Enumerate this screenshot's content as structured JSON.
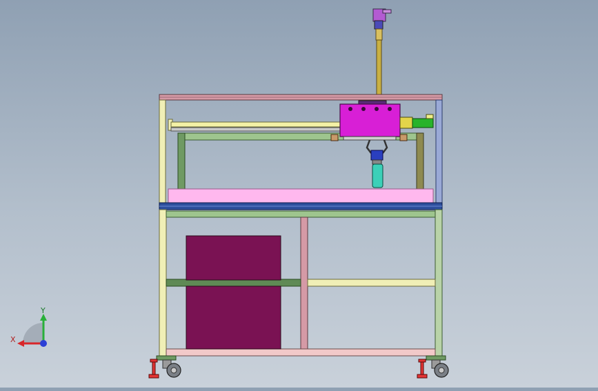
{
  "viewport": {
    "background_top": "#8fa0b3",
    "background_bottom": "#c9d1da"
  },
  "axis_triad": {
    "x_label": "X",
    "y_label": "Y",
    "x_color": "#d8262a",
    "y_color": "#29b03a",
    "z_color": "#2b3fd6"
  },
  "colors": {
    "frame_green": "#6f9a63",
    "frame_light_green": "#b9d3a8",
    "frame_pink": "#d59aa6",
    "frame_cream": "#f0efb6",
    "tabletop_pink": "#ffb8ee",
    "table_rail_blue": "#2d4f9c",
    "cabinet_maroon": "#7a1253",
    "carriage_magenta": "#d81fd6",
    "motor_green": "#28b32a",
    "rod_gold": "#c9b043",
    "gripper_teal": "#3bd0b8",
    "gripper_blue": "#2a3fbf",
    "foot_red": "#e23434",
    "wheel_gray": "#7a7f86"
  }
}
